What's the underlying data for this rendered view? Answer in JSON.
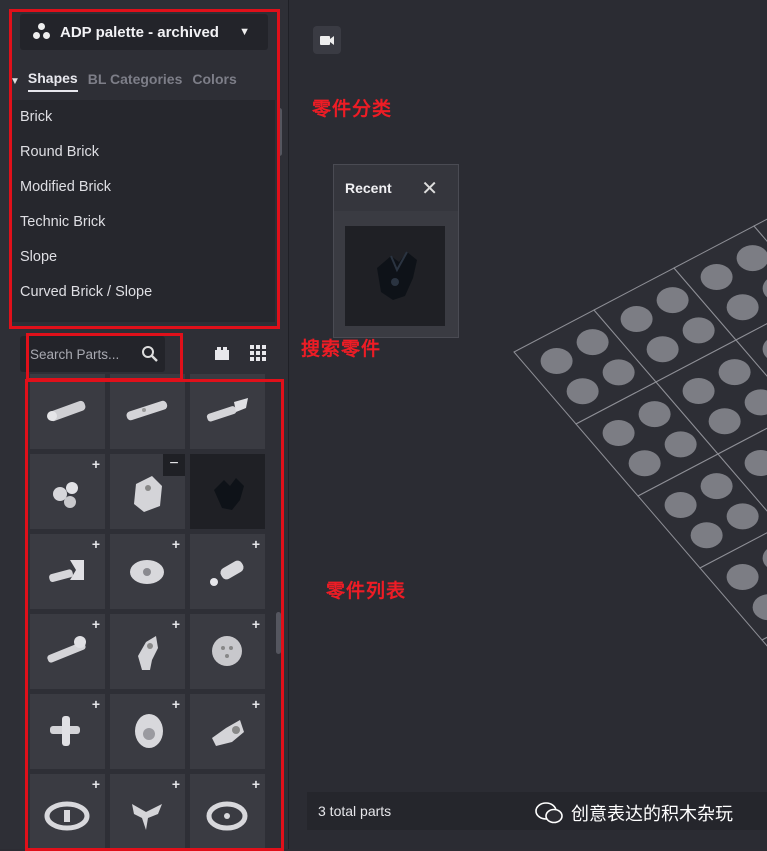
{
  "palette": {
    "label": "ADP palette - archived",
    "icon": "palette-icon"
  },
  "tabs": [
    {
      "label": "Shapes",
      "active": true
    },
    {
      "label": "BL Categories"
    },
    {
      "label": "Colors"
    }
  ],
  "categories": [
    "Brick",
    "Round Brick",
    "Modified Brick",
    "Technic Brick",
    "Slope",
    "Curved Brick / Slope"
  ],
  "search": {
    "placeholder": "Search Parts..."
  },
  "annotations": {
    "categories": "零件分类",
    "search": "搜索零件",
    "parts": "零件列表"
  },
  "recent": {
    "title": "Recent"
  },
  "status": {
    "total_parts": "3 total parts"
  },
  "watermark": {
    "text": "创意表达的积木杂玩"
  },
  "parts": [
    {
      "icon": "technic-pin-icon",
      "action": ""
    },
    {
      "icon": "technic-axle-pin-icon",
      "action": ""
    },
    {
      "icon": "technic-clip-axle-icon",
      "action": ""
    },
    {
      "icon": "technic-ball-joint-icon",
      "action": "+"
    },
    {
      "icon": "technic-connector-icon",
      "action": "−",
      "selected": true
    },
    {
      "icon": "dark-clip-icon",
      "action": "",
      "dark": true
    },
    {
      "icon": "technic-fork-icon",
      "action": "+"
    },
    {
      "icon": "technic-hub-icon",
      "action": "+"
    },
    {
      "icon": "technic-tow-ball-icon",
      "action": "+"
    },
    {
      "icon": "technic-long-pin-icon",
      "action": "+"
    },
    {
      "icon": "technic-steering-arm-icon",
      "action": "+"
    },
    {
      "icon": "technic-disc-icon",
      "action": "+"
    },
    {
      "icon": "technic-cross-joint-icon",
      "action": "+"
    },
    {
      "icon": "technic-bushing-icon",
      "action": "+"
    },
    {
      "icon": "technic-hinge-icon",
      "action": "+"
    },
    {
      "icon": "steering-wheel-icon",
      "action": "+"
    },
    {
      "icon": "technic-wishbone-icon",
      "action": "+"
    },
    {
      "icon": "steering-wheel-small-icon",
      "action": "+"
    }
  ],
  "colors": {
    "accent_red": "#e0101a",
    "panel": "#2e2f36",
    "tile": "#3a3b42"
  }
}
